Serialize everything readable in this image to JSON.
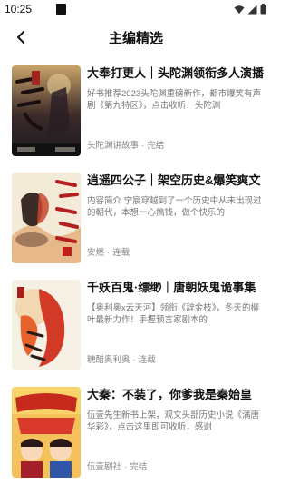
{
  "status_bar": {
    "time": "10:25"
  },
  "header": {
    "title": "主编精选"
  },
  "books": [
    {
      "title": "大奉打更人｜头陀渊领衔多人演播",
      "description": "好书推荐2023头陀渊重磅新作，都市爆笑有声剧《第九特区》，点击收听！头陀渊",
      "author": "头陀渊讲故事",
      "status": "完结",
      "cover_text": "打更人"
    },
    {
      "title": "逍遥四公子｜架空历史&爆笑爽文",
      "description": "内容简介 宁宸穿越到了一个历史中从未出现过的朝代，本想一心搞钱，做个快乐的",
      "author": "安燃",
      "status": "连载",
      "cover_text": "逍遥四公子"
    },
    {
      "title": "千妖百鬼·缥缈｜唐朝妖鬼诡事集",
      "description": "【奥利奥x云天河】领衔《辞金枝》，冬天的柳叶最新力作！手握预言家剧本的",
      "author": "糖醋奥利奥",
      "status": "连载",
      "cover_text": "缥缈"
    },
    {
      "title": "大秦：不装了，你爹我是秦始皇",
      "description": "伍壹先生新书上架，观文头部历史小说《满唐华彩》，点击这里即可收听，感谢",
      "author": "伍壹剧社",
      "status": "完结",
      "cover_text": "你爹我是秦始皇"
    }
  ]
}
